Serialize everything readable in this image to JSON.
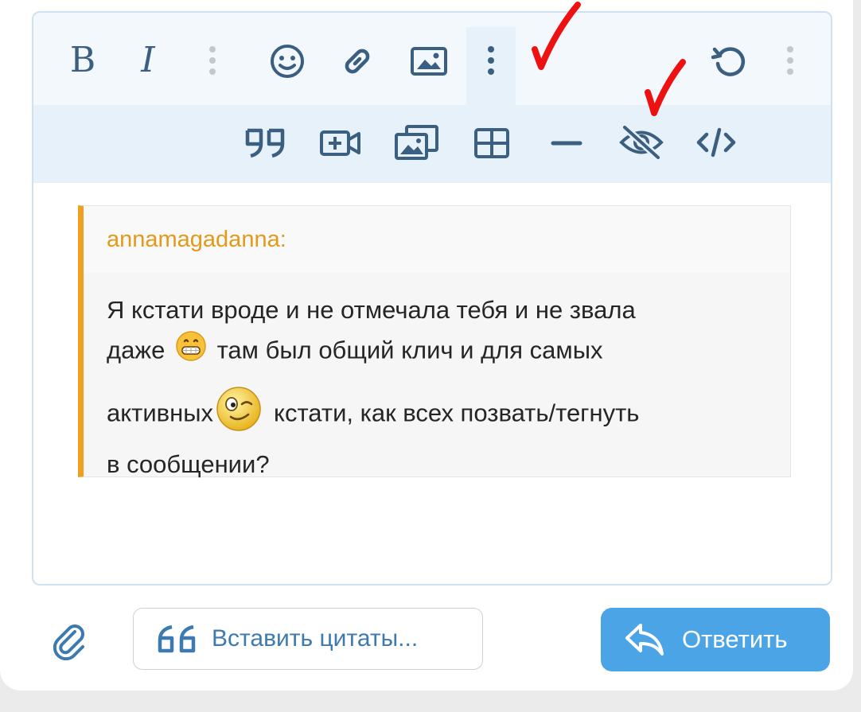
{
  "toolbar": {
    "bold_label": "B",
    "italic_label": "I",
    "row1_icons": [
      "bold-icon",
      "italic-icon",
      "more-vertical-icon",
      "smiley-icon",
      "link-icon",
      "image-icon",
      "more-vertical-icon",
      "undo-icon",
      "more-vertical-icon"
    ],
    "row2_icons": [
      "quote-icon",
      "video-plus-icon",
      "media-gallery-icon",
      "table-icon",
      "horizontal-line-icon",
      "eye-off-icon",
      "code-icon"
    ]
  },
  "quote": {
    "author": "annamagadanna:",
    "line1": "Я кстати вроде и не отмечала тебя и не звала",
    "line2_a": "даже",
    "line2_b": "там был общий клич и для самых",
    "line3_a": "активных",
    "line3_b": "кстати, как всех позвать/тегнуть",
    "line4": "в сообщении?"
  },
  "footer": {
    "insert_quotes_label": "Вставить цитаты...",
    "reply_label": "Ответить"
  },
  "colors": {
    "accent": "#4ba4e6",
    "toolbar_icon": "#3b5f80",
    "quote_border": "#f0a020",
    "quote_author": "#e39a1a",
    "annotation_check": "#ee1111"
  }
}
